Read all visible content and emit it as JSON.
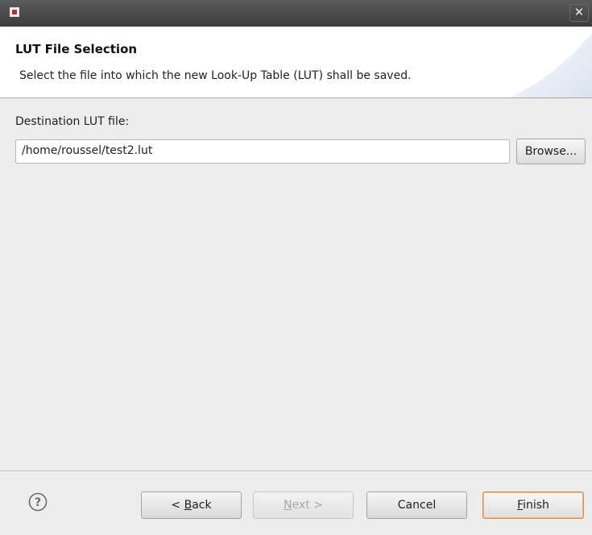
{
  "window": {
    "close_glyph": "✕"
  },
  "header": {
    "title": "LUT File Selection",
    "description": "Select the file into which the new Look-Up Table (LUT) shall be saved."
  },
  "form": {
    "label": "Destination LUT file:",
    "value": "/home/roussel/test2.lut",
    "browse_label": "Browse..."
  },
  "footer": {
    "back": {
      "prefix": "< ",
      "mnemonic": "B",
      "rest": "ack"
    },
    "next": {
      "mnemonic": "N",
      "rest": "ext >",
      "enabled": false
    },
    "cancel_label": "Cancel",
    "finish": {
      "mnemonic": "F",
      "rest": "inish",
      "default": true
    }
  },
  "colors": {
    "titlebar": "#4a4a4a",
    "accent_default_button": "#d58a52",
    "help_icon": "#6b6b6b"
  },
  "icons": {
    "app": "app-icon",
    "close": "close-icon",
    "help": "help-icon"
  }
}
